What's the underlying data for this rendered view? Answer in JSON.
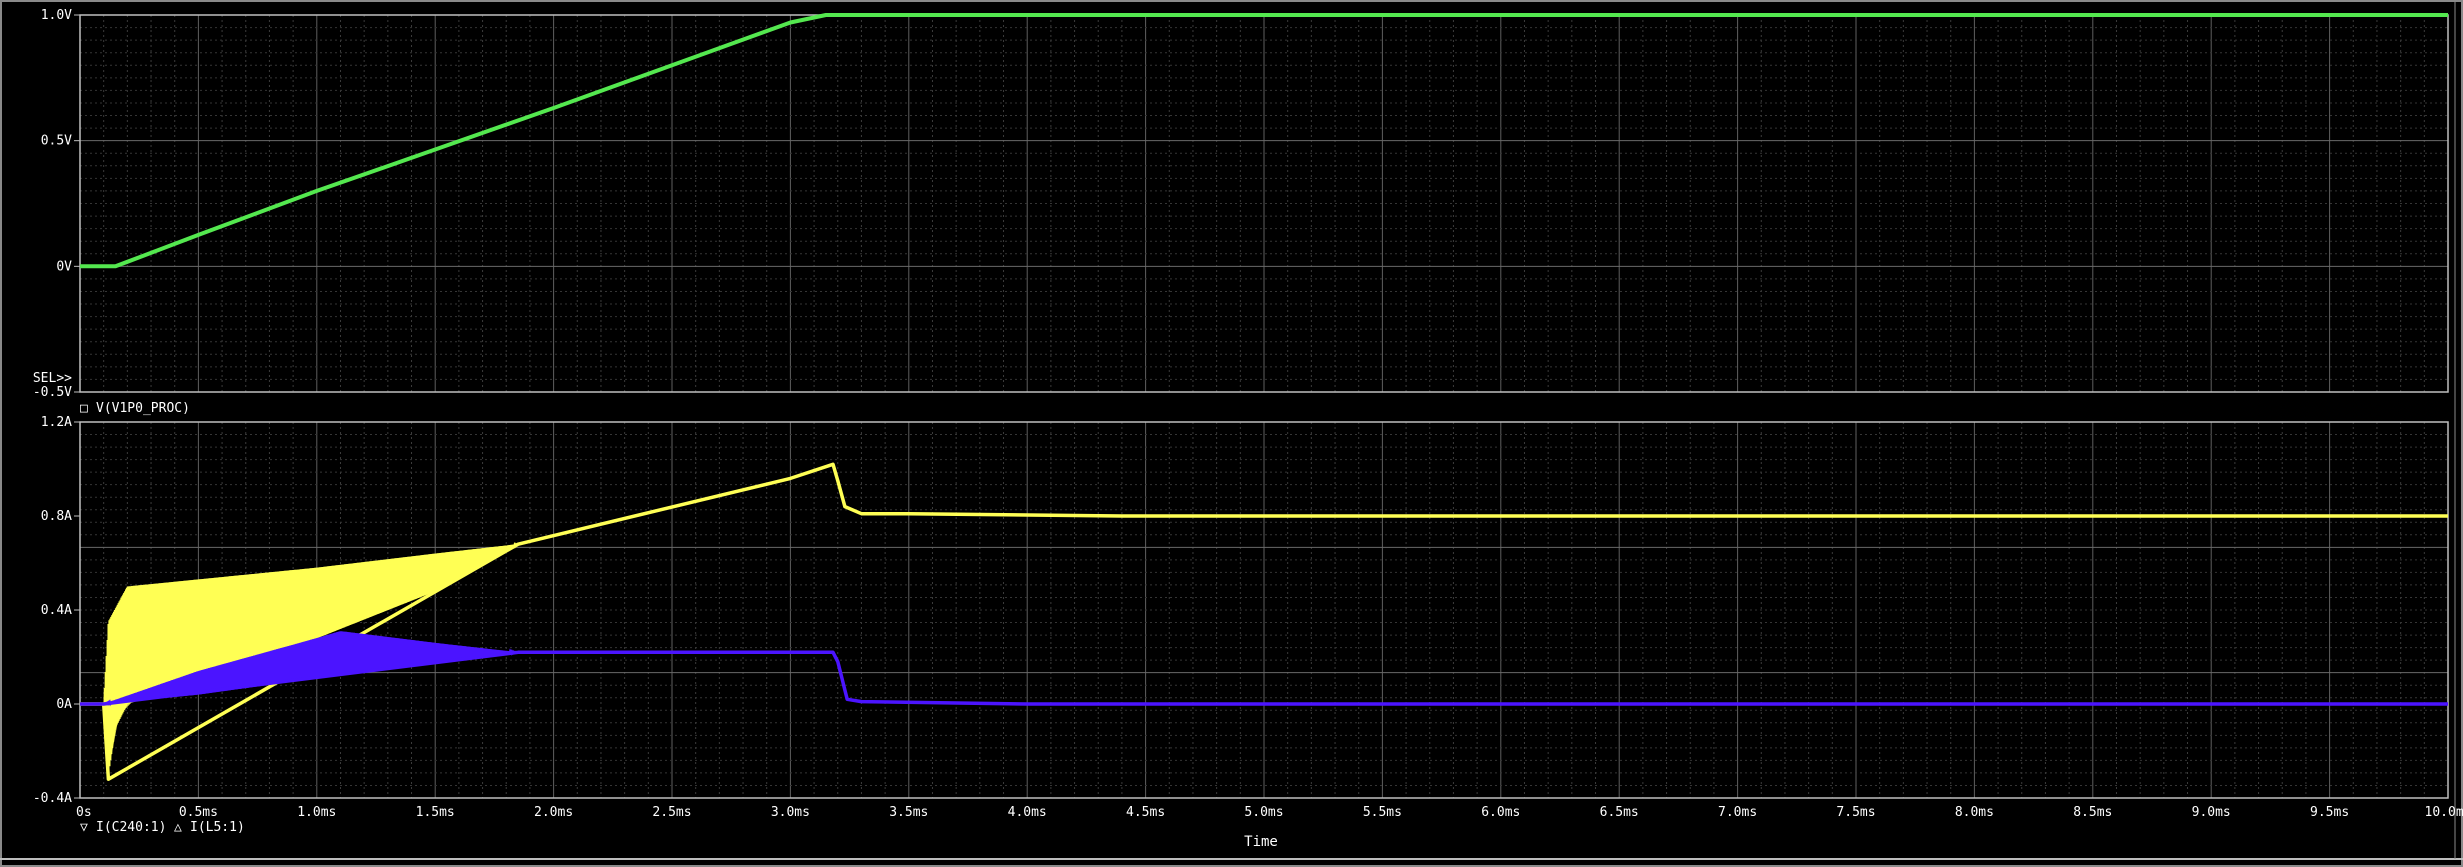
{
  "chart_data": [
    {
      "type": "line",
      "ylim": [
        -0.5,
        1.0
      ],
      "xlim": [
        0,
        10.0
      ],
      "yticks": [
        "1.0V",
        "0.5V",
        "0V",
        "-0.5V"
      ],
      "sel_marker": "SEL>>",
      "grid": true,
      "series": [
        {
          "name": "V(V1P0_PROC)",
          "color": "#54e84f",
          "legend_symbol": "□",
          "x": [
            0,
            0.1,
            0.15,
            0.5,
            1.0,
            1.5,
            2.0,
            2.5,
            3.0,
            3.15,
            3.2,
            4.0,
            5.0,
            6.0,
            7.0,
            8.0,
            9.0,
            10.0
          ],
          "y": [
            0,
            0,
            0.0,
            0.125,
            0.3,
            0.465,
            0.63,
            0.8,
            0.97,
            1.0,
            1.0,
            1.0,
            1.0,
            1.0,
            1.0,
            1.0,
            1.0,
            1.0
          ]
        }
      ]
    },
    {
      "type": "line",
      "ylim": [
        -0.4,
        1.2
      ],
      "xlim": [
        0,
        10.0
      ],
      "yticks": [
        "1.2A",
        "0.8A",
        "0.4A",
        "0A",
        "-0.4A"
      ],
      "xticks": [
        "0s",
        "0.5ms",
        "1.0ms",
        "1.5ms",
        "2.0ms",
        "2.5ms",
        "3.0ms",
        "3.5ms",
        "4.0ms",
        "4.5ms",
        "5.0ms",
        "5.5ms",
        "6.0ms",
        "6.5ms",
        "7.0ms",
        "7.5ms",
        "8.0ms",
        "8.5ms",
        "9.0ms",
        "9.5ms",
        "10.0ms"
      ],
      "xlabel": "Time",
      "grid": true,
      "series": [
        {
          "name": "I(L5:1)",
          "color": "#ffff55",
          "legend_symbol": "△",
          "envelope_upper_x": [
            0.1,
            0.12,
            0.2,
            0.5,
            1.0,
            1.5,
            1.85
          ],
          "envelope_upper_y": [
            0.0,
            0.35,
            0.5,
            0.53,
            0.58,
            0.64,
            0.68
          ],
          "envelope_lower_x": [
            0.1,
            0.12,
            0.15,
            0.2,
            0.5,
            1.0,
            1.5,
            1.85
          ],
          "envelope_lower_y": [
            0.0,
            -0.3,
            -0.1,
            0.0,
            0.1,
            0.28,
            0.48,
            0.68
          ],
          "x": [
            0,
            0.08,
            0.1,
            0.12,
            1.85,
            3.0,
            3.18,
            3.2,
            3.23,
            3.3,
            3.5,
            4.4,
            5.0,
            10.0
          ],
          "y": [
            0,
            0,
            0.0,
            -0.32,
            0.68,
            0.96,
            1.02,
            0.95,
            0.84,
            0.81,
            0.81,
            0.8,
            0.8,
            0.8
          ]
        },
        {
          "name": "I(C240:1)",
          "color": "#4b14ff",
          "legend_symbol": "▽",
          "envelope_upper_x": [
            0.1,
            0.5,
            1.0,
            1.1,
            1.5,
            1.85
          ],
          "envelope_upper_y": [
            0.0,
            0.14,
            0.28,
            0.31,
            0.26,
            0.22
          ],
          "envelope_lower_x": [
            0.1,
            0.5,
            1.0,
            1.5,
            1.85
          ],
          "envelope_lower_y": [
            0.0,
            0.04,
            0.11,
            0.18,
            0.22
          ],
          "x": [
            0,
            0.1,
            1.85,
            3.18,
            3.2,
            3.24,
            3.3,
            4.0,
            10.0
          ],
          "y": [
            0,
            0,
            0.22,
            0.22,
            0.18,
            0.02,
            0.01,
            0.0,
            0.0
          ]
        }
      ]
    }
  ]
}
